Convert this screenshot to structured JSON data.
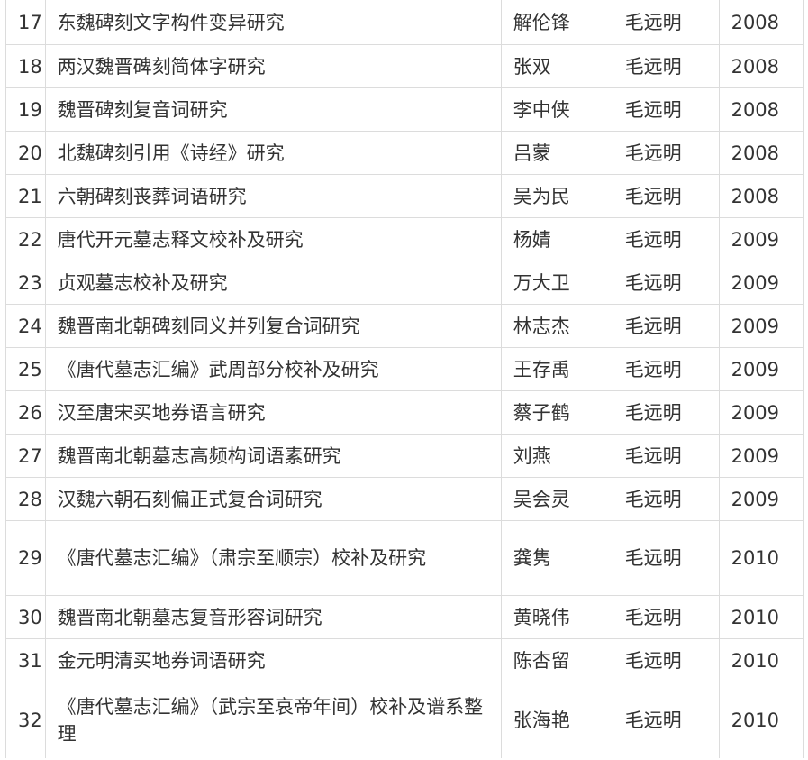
{
  "rows": [
    {
      "no": "17",
      "title": "东魏碑刻文字构件变异研究",
      "author": "解伦锋",
      "advisor": "毛远明",
      "year": "2008"
    },
    {
      "no": "18",
      "title": "两汉魏晋碑刻简体字研究",
      "author": "张双",
      "advisor": "毛远明",
      "year": "2008"
    },
    {
      "no": "19",
      "title": "魏晋碑刻复音词研究",
      "author": "李中侠",
      "advisor": "毛远明",
      "year": "2008"
    },
    {
      "no": "20",
      "title": "北魏碑刻引用《诗经》研究",
      "author": "吕蒙",
      "advisor": "毛远明",
      "year": "2008"
    },
    {
      "no": "21",
      "title": "六朝碑刻丧葬词语研究",
      "author": "吴为民",
      "advisor": "毛远明",
      "year": "2008"
    },
    {
      "no": "22",
      "title": "唐代开元墓志释文校补及研究",
      "author": "杨婧",
      "advisor": "毛远明",
      "year": "2009"
    },
    {
      "no": "23",
      "title": "贞观墓志校补及研究",
      "author": "万大卫",
      "advisor": "毛远明",
      "year": "2009"
    },
    {
      "no": "24",
      "title": "魏晋南北朝碑刻同义并列复合词研究",
      "author": "林志杰",
      "advisor": "毛远明",
      "year": "2009"
    },
    {
      "no": "25",
      "title": "《唐代墓志汇编》武周部分校补及研究",
      "author": "王存禹",
      "advisor": "毛远明",
      "year": "2009"
    },
    {
      "no": "26",
      "title": "汉至唐宋买地券语言研究",
      "author": "蔡子鹤",
      "advisor": "毛远明",
      "year": "2009"
    },
    {
      "no": "27",
      "title": "魏晋南北朝墓志高频构词语素研究",
      "author": "刘燕",
      "advisor": "毛远明",
      "year": "2009"
    },
    {
      "no": "28",
      "title": "汉魏六朝石刻偏正式复合词研究",
      "author": "吴会灵",
      "advisor": "毛远明",
      "year": "2009"
    },
    {
      "no": "29",
      "title": "《唐代墓志汇编》（肃宗至顺宗）校补及研究",
      "author": "龚隽",
      "advisor": "毛远明",
      "year": "2010"
    },
    {
      "no": "30",
      "title": "魏晋南北朝墓志复音形容词研究",
      "author": "黄晓伟",
      "advisor": "毛远明",
      "year": "2010"
    },
    {
      "no": "31",
      "title": "金元明清买地券词语研究",
      "author": "陈杏留",
      "advisor": "毛远明",
      "year": "2010"
    },
    {
      "no": "32",
      "title": "《唐代墓志汇编》（武宗至哀帝年间）校补及谱系整理",
      "author": "张海艳",
      "advisor": "毛远明",
      "year": "2010"
    }
  ]
}
